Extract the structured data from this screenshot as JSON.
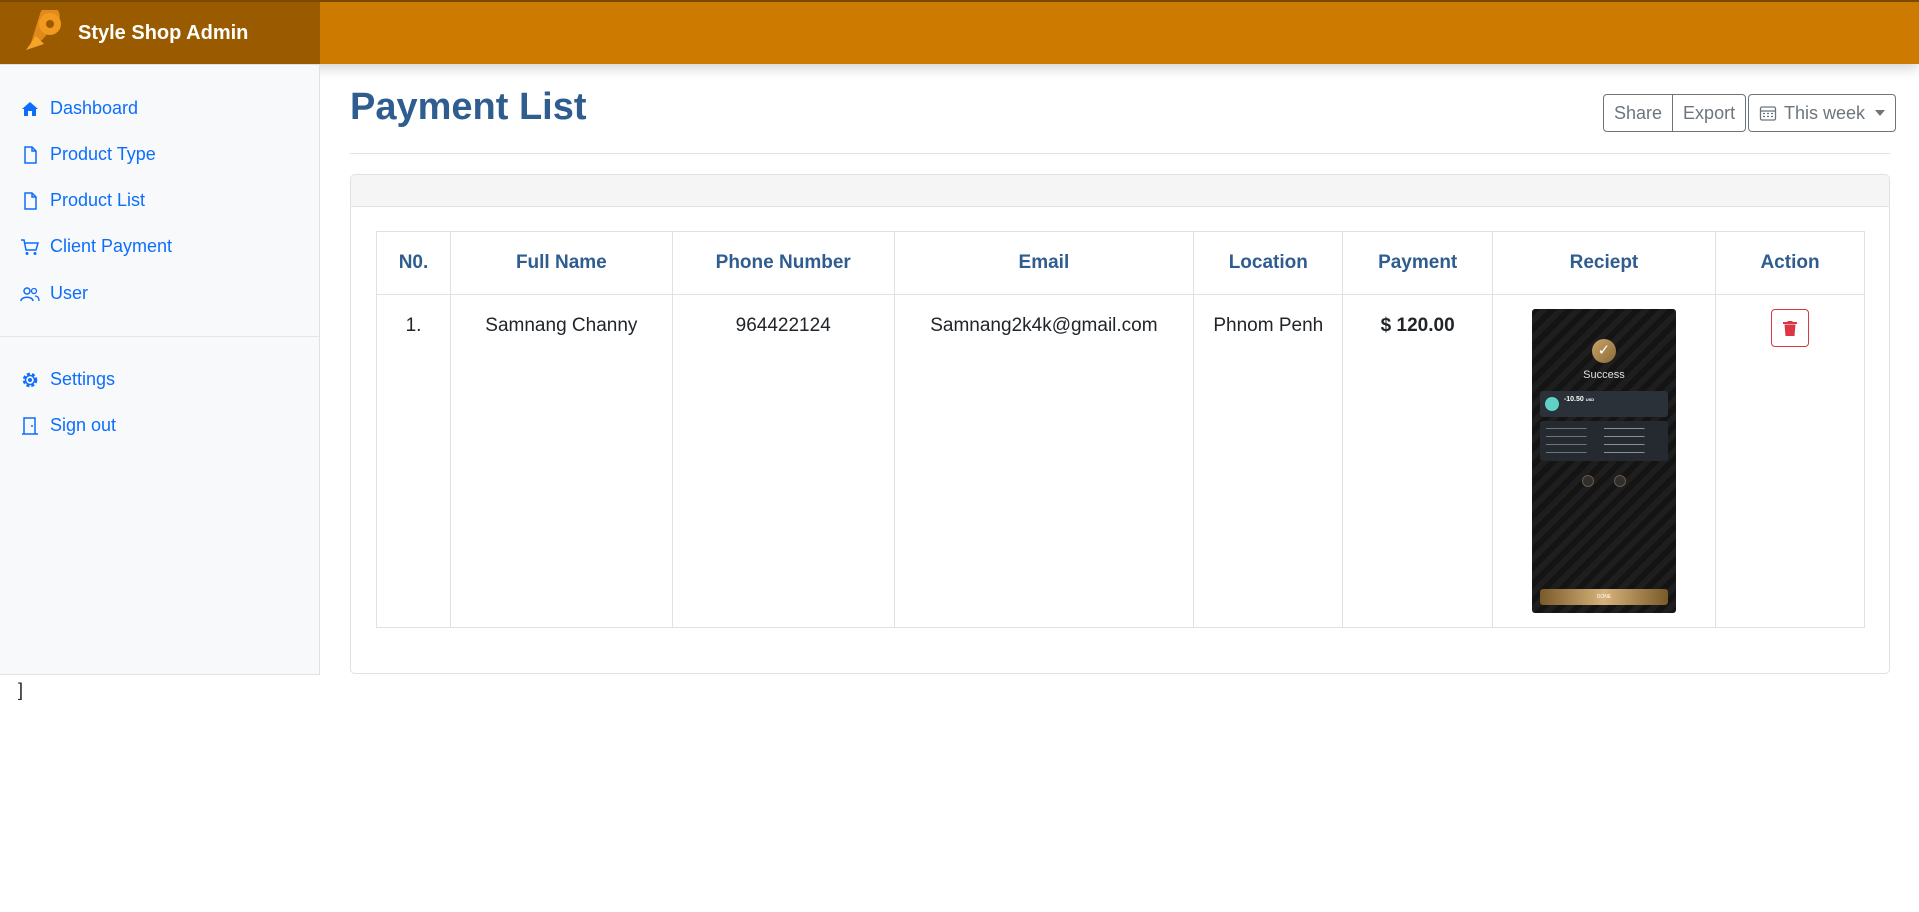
{
  "brand": {
    "name": "Style Shop Admin",
    "accent": "#cc7a00",
    "brand_bg": "#9a5b00",
    "logo_icon": "map-pin-logo-icon"
  },
  "sidebar": {
    "items": [
      {
        "label": "Dashboard",
        "icon": "home-icon"
      },
      {
        "label": "Product Type",
        "icon": "file-icon"
      },
      {
        "label": "Product List",
        "icon": "file-icon"
      },
      {
        "label": "Client Payment",
        "icon": "cart-icon"
      },
      {
        "label": "User",
        "icon": "users-icon"
      },
      {
        "label": "Settings",
        "icon": "gear-icon"
      },
      {
        "label": "Sign out",
        "icon": "door-icon"
      }
    ]
  },
  "main": {
    "title": "Payment List",
    "toolbar": {
      "share_label": "Share",
      "export_label": "Export",
      "period_label": "This week"
    }
  },
  "table": {
    "headers": [
      "N0.",
      "Full Name",
      "Phone Number",
      "Email",
      "Location",
      "Payment",
      "Reciept",
      "Action"
    ],
    "rows": [
      {
        "no": "1.",
        "full_name": "Samnang Channy",
        "phone": "964422124",
        "email": "Samnang2k4k@gmail.com",
        "location": "Phnom Penh",
        "payment": "$ 120.00",
        "receipt": {
          "status": "Success",
          "amount": "-10.50",
          "currency": "USD",
          "button": "DONE"
        }
      }
    ]
  },
  "stray_text": "]",
  "colors": {
    "link": "#0d6efd",
    "heading": "#2f5d8f",
    "danger": "#dc3545"
  }
}
